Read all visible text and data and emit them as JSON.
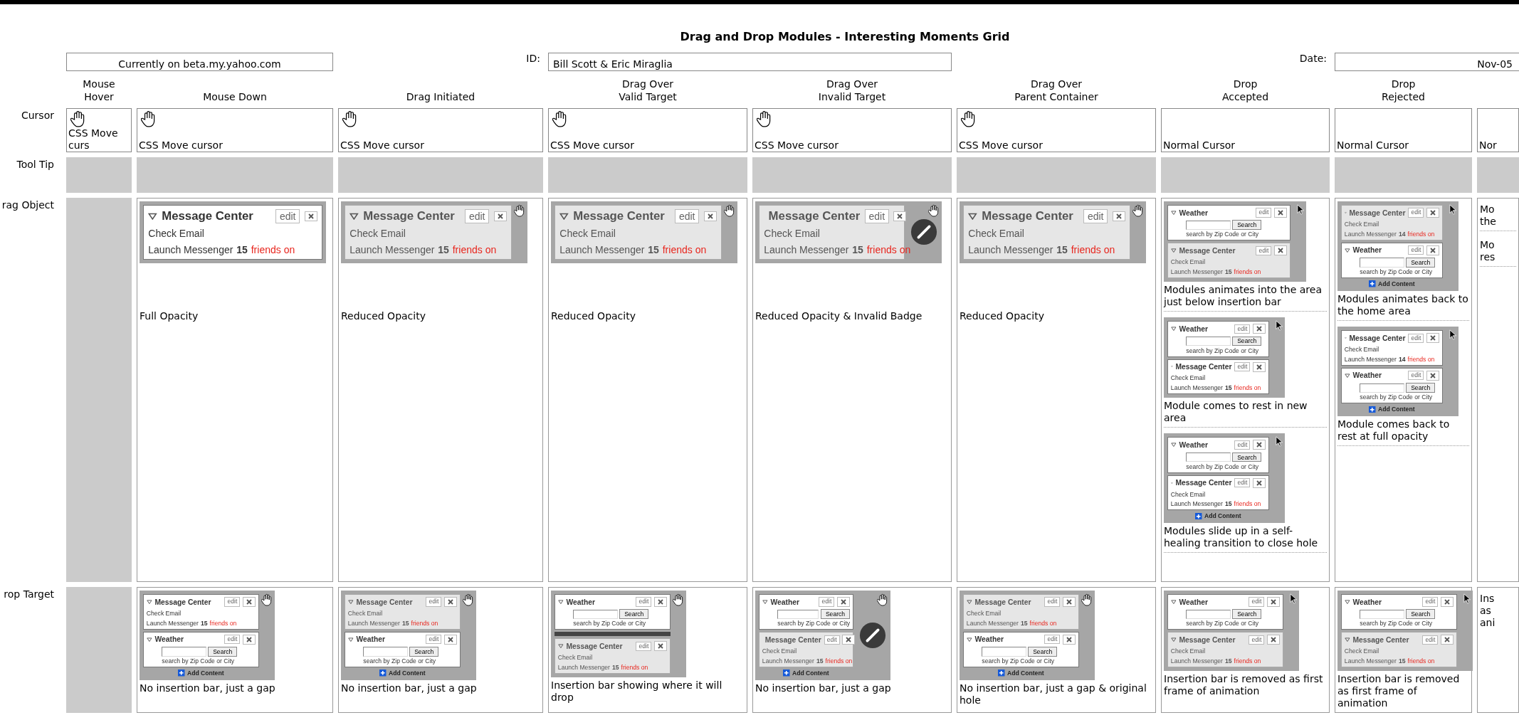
{
  "title": "Drag and Drop Modules - Interesting Moments Grid",
  "info": {
    "location": "Currently on beta.my.yahoo.com",
    "id_label": "ID:",
    "id": "Bill Scott & Eric Miraglia",
    "date_label": "Date:",
    "date": "Nov-05"
  },
  "columns": [
    {
      "heading": "Mouse\nHover"
    },
    {
      "heading": "Mouse Down"
    },
    {
      "heading": "Drag Initiated"
    },
    {
      "heading": "Drag Over\nValid Target"
    },
    {
      "heading": "Drag Over\nInvalid Target"
    },
    {
      "heading": "Drag Over\nParent Container"
    },
    {
      "heading": "Drop\nAccepted"
    },
    {
      "heading": "Drop\nRejected"
    }
  ],
  "rows": [
    {
      "label": "Cursor",
      "kind": "cursor",
      "cells": [
        {
          "kind": "hand",
          "label": "CSS Move curs"
        },
        {
          "kind": "hand",
          "label": "CSS Move cursor"
        },
        {
          "kind": "hand",
          "label": "CSS Move cursor"
        },
        {
          "kind": "hand",
          "label": "CSS Move cursor"
        },
        {
          "kind": "hand",
          "label": "CSS Move cursor"
        },
        {
          "kind": "hand",
          "label": "CSS Move cursor"
        },
        {
          "kind": "plain",
          "label": "Normal Cursor"
        },
        {
          "kind": "plain",
          "label": "Normal Cursor"
        },
        {
          "kind": "plain",
          "label": "Nor"
        }
      ]
    },
    {
      "label": "Tool Tip",
      "kind": "blank",
      "cells": [
        {
          "kind": "blank"
        },
        {
          "kind": "blank"
        },
        {
          "kind": "blank"
        },
        {
          "kind": "blank"
        },
        {
          "kind": "blank"
        },
        {
          "kind": "blank"
        },
        {
          "kind": "blank"
        },
        {
          "kind": "blank"
        },
        {
          "kind": "blank"
        }
      ]
    },
    {
      "label": "rag Object",
      "kind": "drag_object",
      "cells": [
        {
          "kind": "blank"
        },
        {
          "kind": "frames",
          "frames": [
            {
              "thumb": {
                "kind": "large",
                "items": [
                  {
                    "kind": "message",
                    "faded": false,
                    "title": "Message Center",
                    "edit": "edit",
                    "link": "Check Email",
                    "messenger": "Launch Messenger",
                    "count": "15",
                    "status": "friends on"
                  }
                ]
              },
              "caption": "Full Opacity"
            }
          ]
        },
        {
          "kind": "frames",
          "frames": [
            {
              "thumb": {
                "kind": "large",
                "items": [
                  {
                    "kind": "message",
                    "faded": true,
                    "title": "Message Center",
                    "edit": "edit",
                    "link": "Check Email",
                    "messenger": "Launch Messenger",
                    "count": "15",
                    "status": "friends on"
                  },
                  {
                    "kind": "hand_pointer"
                  }
                ]
              },
              "caption": "Reduced Opacity"
            }
          ]
        },
        {
          "kind": "frames",
          "frames": [
            {
              "thumb": {
                "kind": "large",
                "items": [
                  {
                    "kind": "message",
                    "faded": true,
                    "title": "Message Center",
                    "edit": "edit",
                    "link": "Check Email",
                    "messenger": "Launch Messenger",
                    "count": "15",
                    "status": "friends on"
                  },
                  {
                    "kind": "hand_pointer"
                  }
                ]
              },
              "caption": "Reduced Opacity"
            }
          ]
        },
        {
          "kind": "frames",
          "frames": [
            {
              "thumb": {
                "kind": "large",
                "items": [
                  {
                    "kind": "message",
                    "faded": true,
                    "title": "Message Center",
                    "edit": "edit",
                    "link": "Check Email",
                    "messenger": "Launch Messenger",
                    "count": "15",
                    "status": "friends on"
                  },
                  {
                    "kind": "badge"
                  },
                  {
                    "kind": "hand_pointer"
                  }
                ]
              },
              "caption": "Reduced Opacity & Invalid Badge"
            }
          ]
        },
        {
          "kind": "frames",
          "frames": [
            {
              "thumb": {
                "kind": "large",
                "items": [
                  {
                    "kind": "message",
                    "faded": true,
                    "title": "Message Center",
                    "edit": "edit",
                    "link": "Check Email",
                    "messenger": "Launch Messenger",
                    "count": "15",
                    "status": "friends on"
                  },
                  {
                    "kind": "hand_pointer"
                  }
                ]
              },
              "caption": "Reduced Opacity"
            }
          ]
        },
        {
          "kind": "frames",
          "frames": [
            {
              "thumb": {
                "kind": "medium",
                "items": [
                  {
                    "kind": "weather",
                    "faded": false,
                    "title": "Weather",
                    "edit": "edit",
                    "button": "Search",
                    "hint": "search by Zip Code or City"
                  },
                  {
                    "kind": "message",
                    "faded": true,
                    "title": "Message Center",
                    "edit": "edit",
                    "link": "Check Email",
                    "messenger": "Launch Messenger",
                    "count": "15",
                    "status": "friends on"
                  },
                  {
                    "kind": "arrow_pointer"
                  }
                ]
              },
              "caption": "Modules animates into the area just below insertion bar"
            },
            {
              "thumb": {
                "kind": "small",
                "items": [
                  {
                    "kind": "weather",
                    "faded": false,
                    "title": "Weather",
                    "edit": "edit",
                    "button": "Search",
                    "hint": "search by Zip Code or City"
                  },
                  {
                    "kind": "message",
                    "faded": false,
                    "title": "Message Center",
                    "edit": "edit",
                    "link": "Check Email",
                    "messenger": "Launch Messenger",
                    "count": "15",
                    "status": "friends on"
                  },
                  {
                    "kind": "arrow_pointer"
                  }
                ]
              },
              "caption": "Module comes to rest in new area"
            },
            {
              "thumb": {
                "kind": "small",
                "items": [
                  {
                    "kind": "weather",
                    "faded": false,
                    "title": "Weather",
                    "edit": "edit",
                    "button": "Search",
                    "hint": "search by Zip Code or City"
                  },
                  {
                    "kind": "message",
                    "faded": false,
                    "title": "Message Center",
                    "edit": "edit",
                    "link": "Check Email",
                    "messenger": "Launch Messenger",
                    "count": "15",
                    "status": "friends on"
                  },
                  {
                    "kind": "add",
                    "label": "Add Content"
                  },
                  {
                    "kind": "arrow_pointer"
                  }
                ]
              },
              "caption": "Modules slide up in a self-healing transition to close hole"
            }
          ]
        },
        {
          "kind": "frames",
          "frames": [
            {
              "thumb": {
                "kind": "small",
                "items": [
                  {
                    "kind": "message",
                    "faded": true,
                    "title": "Message Center",
                    "edit": "edit",
                    "link": "Check Email",
                    "messenger": "Launch Messenger",
                    "count": "14",
                    "status": "friends on"
                  },
                  {
                    "kind": "weather",
                    "faded": false,
                    "title": "Weather",
                    "edit": "edit",
                    "button": "Search",
                    "hint": "search by Zip Code or City"
                  },
                  {
                    "kind": "add",
                    "label": "Add Content"
                  },
                  {
                    "kind": "arrow_pointer"
                  }
                ]
              },
              "caption": "Modules animates back to the home area"
            },
            {
              "thumb": {
                "kind": "small",
                "items": [
                  {
                    "kind": "message",
                    "faded": false,
                    "title": "Message Center",
                    "edit": "edit",
                    "link": "Check Email",
                    "messenger": "Launch Messenger",
                    "count": "14",
                    "status": "friends on"
                  },
                  {
                    "kind": "weather",
                    "faded": false,
                    "title": "Weather",
                    "edit": "edit",
                    "button": "Search",
                    "hint": "search by Zip Code or City"
                  },
                  {
                    "kind": "add",
                    "label": "Add Content"
                  },
                  {
                    "kind": "arrow_pointer"
                  }
                ]
              },
              "caption": "Module comes back to rest at full opacity"
            }
          ]
        },
        {
          "kind": "frames",
          "frames": [
            {
              "caption": "Mo the"
            },
            {
              "caption": "Mo res"
            }
          ]
        }
      ]
    },
    {
      "label": "rop Target",
      "kind": "drop_target",
      "cells": [
        {
          "kind": "blank"
        },
        {
          "kind": "frames",
          "frames": [
            {
              "thumb": {
                "kind": "medium",
                "items": [
                  {
                    "kind": "message",
                    "faded": false,
                    "title": "Message Center",
                    "edit": "edit",
                    "link": "Check Email",
                    "messenger": "Launch Messenger",
                    "count": "15",
                    "status": "friends on"
                  },
                  {
                    "kind": "weather",
                    "faded": false,
                    "title": "Weather",
                    "edit": "edit",
                    "button": "Search",
                    "hint": "search by Zip Code or City"
                  },
                  {
                    "kind": "add",
                    "label": "Add Content"
                  },
                  {
                    "kind": "hand_pointer"
                  }
                ]
              },
              "caption": "No insertion bar, just a gap"
            }
          ]
        },
        {
          "kind": "frames",
          "frames": [
            {
              "thumb": {
                "kind": "medium",
                "items": [
                  {
                    "kind": "message",
                    "faded": true,
                    "title": "Message Center",
                    "edit": "edit",
                    "link": "Check Email",
                    "messenger": "Launch Messenger",
                    "count": "15",
                    "status": "friends on"
                  },
                  {
                    "kind": "weather",
                    "faded": false,
                    "title": "Weather",
                    "edit": "edit",
                    "button": "Search",
                    "hint": "search by Zip Code or City"
                  },
                  {
                    "kind": "add",
                    "label": "Add Content"
                  },
                  {
                    "kind": "hand_pointer"
                  }
                ]
              },
              "caption": "No insertion bar, just a gap"
            }
          ]
        },
        {
          "kind": "frames",
          "frames": [
            {
              "thumb": {
                "kind": "medium",
                "items": [
                  {
                    "kind": "weather",
                    "faded": false,
                    "title": "Weather",
                    "edit": "edit",
                    "button": "Search",
                    "hint": "search by Zip Code or City"
                  },
                  {
                    "kind": "bar"
                  },
                  {
                    "kind": "message",
                    "faded": true,
                    "title": "Message Center",
                    "edit": "edit",
                    "link": "Check Email",
                    "messenger": "Launch Messenger",
                    "count": "15",
                    "status": "friends on"
                  },
                  {
                    "kind": "hand_pointer"
                  }
                ]
              },
              "caption": "Insertion bar showing where it will drop"
            }
          ]
        },
        {
          "kind": "frames",
          "frames": [
            {
              "thumb": {
                "kind": "medium",
                "items": [
                  {
                    "kind": "weather",
                    "faded": false,
                    "title": "Weather",
                    "edit": "edit",
                    "button": "Search",
                    "hint": "search by Zip Code or City"
                  },
                  {
                    "kind": "message",
                    "faded": true,
                    "title": "Message Center",
                    "edit": "edit",
                    "link": "Check Email",
                    "messenger": "Launch Messenger",
                    "count": "15",
                    "status": "friends on"
                  },
                  {
                    "kind": "badge"
                  },
                  {
                    "kind": "add",
                    "label": "Add Content"
                  },
                  {
                    "kind": "hand_pointer"
                  }
                ]
              },
              "caption": "No insertion bar, just a gap"
            }
          ]
        },
        {
          "kind": "frames",
          "frames": [
            {
              "thumb": {
                "kind": "medium",
                "items": [
                  {
                    "kind": "message",
                    "faded": true,
                    "title": "Message Center",
                    "edit": "edit",
                    "link": "Check Email",
                    "messenger": "Launch Messenger",
                    "count": "15",
                    "status": "friends on"
                  },
                  {
                    "kind": "weather",
                    "faded": false,
                    "title": "Weather",
                    "edit": "edit",
                    "button": "Search",
                    "hint": "search by Zip Code or City"
                  },
                  {
                    "kind": "add",
                    "label": "Add Content"
                  },
                  {
                    "kind": "hand_pointer"
                  }
                ]
              },
              "caption": "No insertion bar, just a gap & original hole"
            }
          ]
        },
        {
          "kind": "frames",
          "frames": [
            {
              "thumb": {
                "kind": "medium",
                "items": [
                  {
                    "kind": "weather",
                    "faded": false,
                    "title": "Weather",
                    "edit": "edit",
                    "button": "Search",
                    "hint": "search by Zip Code or City"
                  },
                  {
                    "kind": "message",
                    "faded": true,
                    "title": "Message Center",
                    "edit": "edit",
                    "link": "Check Email",
                    "messenger": "Launch Messenger",
                    "count": "15",
                    "status": "friends on"
                  },
                  {
                    "kind": "arrow_pointer"
                  }
                ]
              },
              "caption": "Insertion bar is removed as first frame of animation"
            }
          ]
        },
        {
          "kind": "frames",
          "frames": [
            {
              "thumb": {
                "kind": "medium",
                "items": [
                  {
                    "kind": "weather",
                    "faded": false,
                    "title": "Weather",
                    "edit": "edit",
                    "button": "Search",
                    "hint": "search by Zip Code or City"
                  },
                  {
                    "kind": "message",
                    "faded": true,
                    "title": "Message Center",
                    "edit": "edit",
                    "link": "Check Email",
                    "messenger": "Launch Messenger",
                    "count": "15",
                    "status": "friends on"
                  },
                  {
                    "kind": "arrow_pointer"
                  }
                ]
              },
              "caption": "Insertion bar is removed as first frame of animation"
            }
          ]
        },
        {
          "kind": "frames",
          "frames": [
            {
              "caption": "Ins as ani"
            }
          ]
        }
      ]
    }
  ]
}
